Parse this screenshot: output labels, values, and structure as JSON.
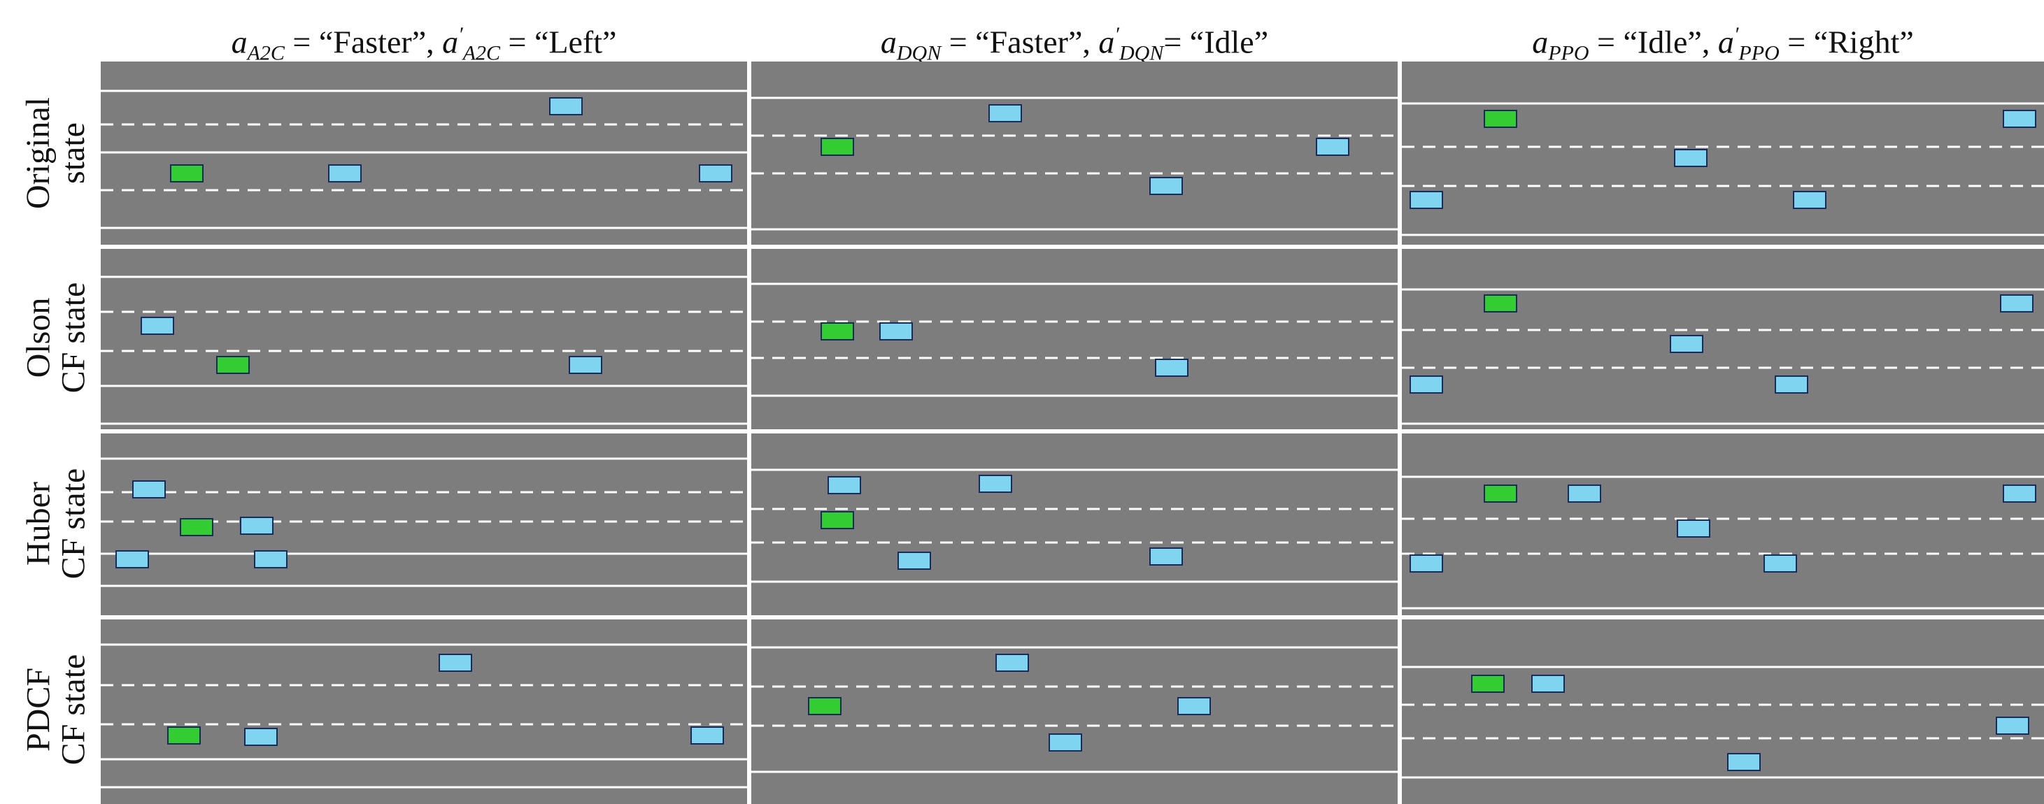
{
  "columns": [
    {
      "a_sub": "A2C",
      "a_val": "“Faster”",
      "ap_sub": "A2C",
      "ap_val": "“Left”"
    },
    {
      "a_sub": "DQN",
      "a_val": "“Faster”",
      "ap_sub": "DQN",
      "ap_val": "“Idle”"
    },
    {
      "a_sub": "PPO",
      "a_val": "“Idle”",
      "ap_sub": "PPO",
      "ap_val": "“Right”"
    }
  ],
  "rows": [
    {
      "line1": "Original",
      "line2": "state"
    },
    {
      "line1": "Olson",
      "line2": "CF state"
    },
    {
      "line1": "Huber",
      "line2": "CF state"
    },
    {
      "line1": "PDCF",
      "line2": "CF state"
    }
  ],
  "colors": {
    "road": "#7d7d7d",
    "lane_line": "#ffffff",
    "ego_vehicle": "#33cc33",
    "other_vehicle": "#7fd4f0",
    "vehicle_border": "#1a2a5a"
  }
}
